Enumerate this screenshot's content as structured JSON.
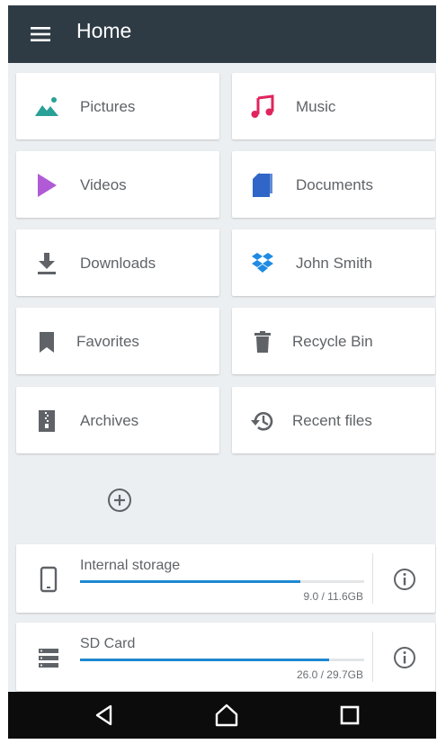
{
  "header": {
    "title": "Home",
    "menu_icon": "hamburger-menu-icon"
  },
  "tiles": [
    {
      "label": "Pictures",
      "icon": "landscape-image-icon",
      "color": "#2aa198"
    },
    {
      "label": "Music",
      "icon": "music-note-icon",
      "color": "#e0245e"
    },
    {
      "label": "Videos",
      "icon": "play-triangle-icon",
      "color": "#b05ad6"
    },
    {
      "label": "Documents",
      "icon": "document-stack-icon",
      "color": "#2f66c8"
    },
    {
      "label": "Downloads",
      "icon": "download-arrow-icon",
      "color": "#5f6367"
    },
    {
      "label": "John Smith",
      "icon": "dropbox-icon",
      "color": "#1f8be3"
    },
    {
      "label": "Favorites",
      "icon": "bookmark-icon",
      "color": "#5f6367"
    },
    {
      "label": "Recycle Bin",
      "icon": "trash-icon",
      "color": "#5f6367"
    },
    {
      "label": "Archives",
      "icon": "zip-archive-icon",
      "color": "#5f6367"
    },
    {
      "label": "Recent files",
      "icon": "history-clock-icon",
      "color": "#5f6367"
    }
  ],
  "add_button": {
    "icon": "add-circle-icon"
  },
  "storage": [
    {
      "name": "Internal storage",
      "size": "9.0 / 11.6GB",
      "used_fraction": 0.776,
      "icon": "phone-icon"
    },
    {
      "name": "SD Card",
      "size": "26.0 / 29.7GB",
      "used_fraction": 0.875,
      "icon": "sd-card-icon"
    }
  ],
  "navbar": {
    "back_icon": "back-triangle-icon",
    "home_icon": "home-icon",
    "recents_icon": "recents-square-icon"
  },
  "colors": {
    "header_bg": "#2f3b44",
    "background": "#eceff1",
    "accent": "#1e88d1"
  }
}
